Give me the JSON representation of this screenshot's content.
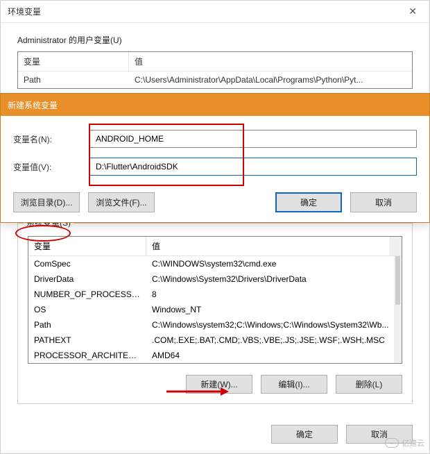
{
  "parent": {
    "title": "环境变量",
    "close": "✕",
    "user_vars_label": "Administrator 的用户变量(U)",
    "headers": {
      "var": "变量",
      "val": "值"
    },
    "rows": [
      {
        "var": "Path",
        "val": "C:\\Users\\Administrator\\AppData\\Local\\Programs\\Python\\Pyt..."
      }
    ]
  },
  "child": {
    "title": "新建系统变量",
    "name_label": "变量名(N):",
    "name_value": "ANDROID_HOME",
    "value_label": "变量值(V):",
    "value_value": "D:\\Flutter\\AndroidSDK",
    "browse_dir": "浏览目录(D)...",
    "browse_file": "浏览文件(F)...",
    "ok": "确定",
    "cancel": "取消"
  },
  "sys": {
    "legend": "系统变量(S)",
    "headers": {
      "var": "变量",
      "val": "值"
    },
    "rows": [
      {
        "var": "ComSpec",
        "val": "C:\\WINDOWS\\system32\\cmd.exe"
      },
      {
        "var": "DriverData",
        "val": "C:\\Windows\\System32\\Drivers\\DriverData"
      },
      {
        "var": "NUMBER_OF_PROCESSORS",
        "val": "8"
      },
      {
        "var": "OS",
        "val": "Windows_NT"
      },
      {
        "var": "Path",
        "val": "C:\\Windows\\system32;C:\\Windows;C:\\Windows\\System32\\Wb..."
      },
      {
        "var": "PATHEXT",
        "val": ".COM;.EXE;.BAT;.CMD;.VBS;.VBE;.JS;.JSE;.WSF;.WSH;.MSC"
      },
      {
        "var": "PROCESSOR_ARCHITECT...",
        "val": "AMD64"
      }
    ],
    "new": "新建(W)...",
    "edit": "编辑(I)...",
    "delete": "删除(L)"
  },
  "bottom": {
    "ok": "确定",
    "cancel": "取消"
  },
  "watermark": "亿速云"
}
